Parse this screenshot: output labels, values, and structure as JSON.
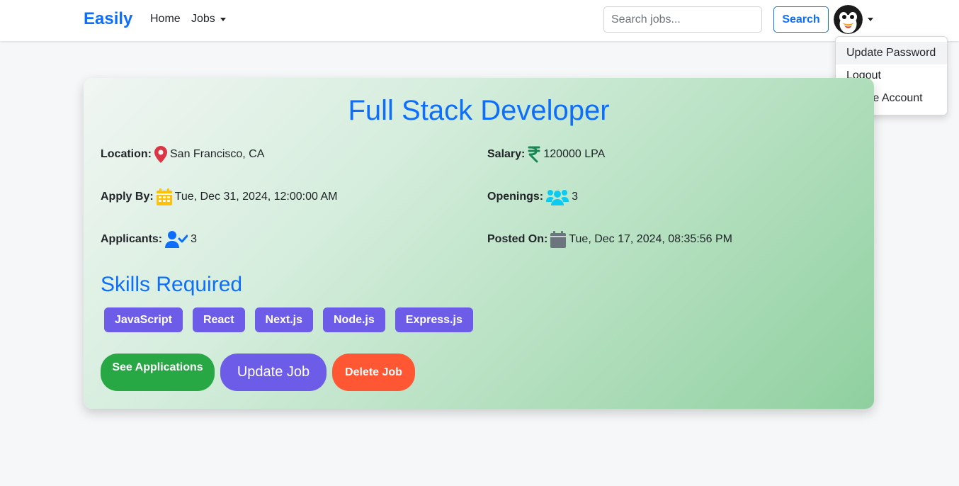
{
  "navbar": {
    "brand": "Easily",
    "home_label": "Home",
    "jobs_label": "Jobs",
    "search_placeholder": "Search jobs...",
    "search_label": "Search"
  },
  "user_menu": {
    "items": [
      "Update Password",
      "Logout",
      "Delete Account"
    ]
  },
  "job": {
    "title": "Full Stack Developer",
    "location_label": "Location:",
    "location": "San Francisco, CA",
    "salary_label": "Salary:",
    "salary": "120000 LPA",
    "apply_by_label": "Apply By:",
    "apply_by": "Tue, Dec 31, 2024, 12:00:00 AM",
    "openings_label": "Openings:",
    "openings": "3",
    "applicants_label": "Applicants:",
    "applicants": "3",
    "posted_on_label": "Posted On:",
    "posted_on": "Tue, Dec 17, 2024, 08:35:56 PM",
    "skills_heading": "Skills Required",
    "skills": [
      "JavaScript",
      "React",
      "Next.js",
      "Node.js",
      "Express.js"
    ],
    "actions": {
      "see_applications": "See Applications",
      "update_job": "Update Job",
      "delete_job": "Delete Job"
    }
  },
  "icons": {
    "location": "map-pin-icon",
    "salary": "rupee-icon",
    "apply_by": "calendar-icon",
    "openings": "users-icon",
    "applicants": "user-check-icon",
    "posted_on": "calendar-solid-icon",
    "avatar": "penguin-avatar"
  },
  "colors": {
    "primary": "#0d6efd",
    "skill_badge": "#6c5ce7",
    "see_applications": "#28a745",
    "update_job": "#6c5ce7",
    "delete_job": "#ff5733"
  }
}
